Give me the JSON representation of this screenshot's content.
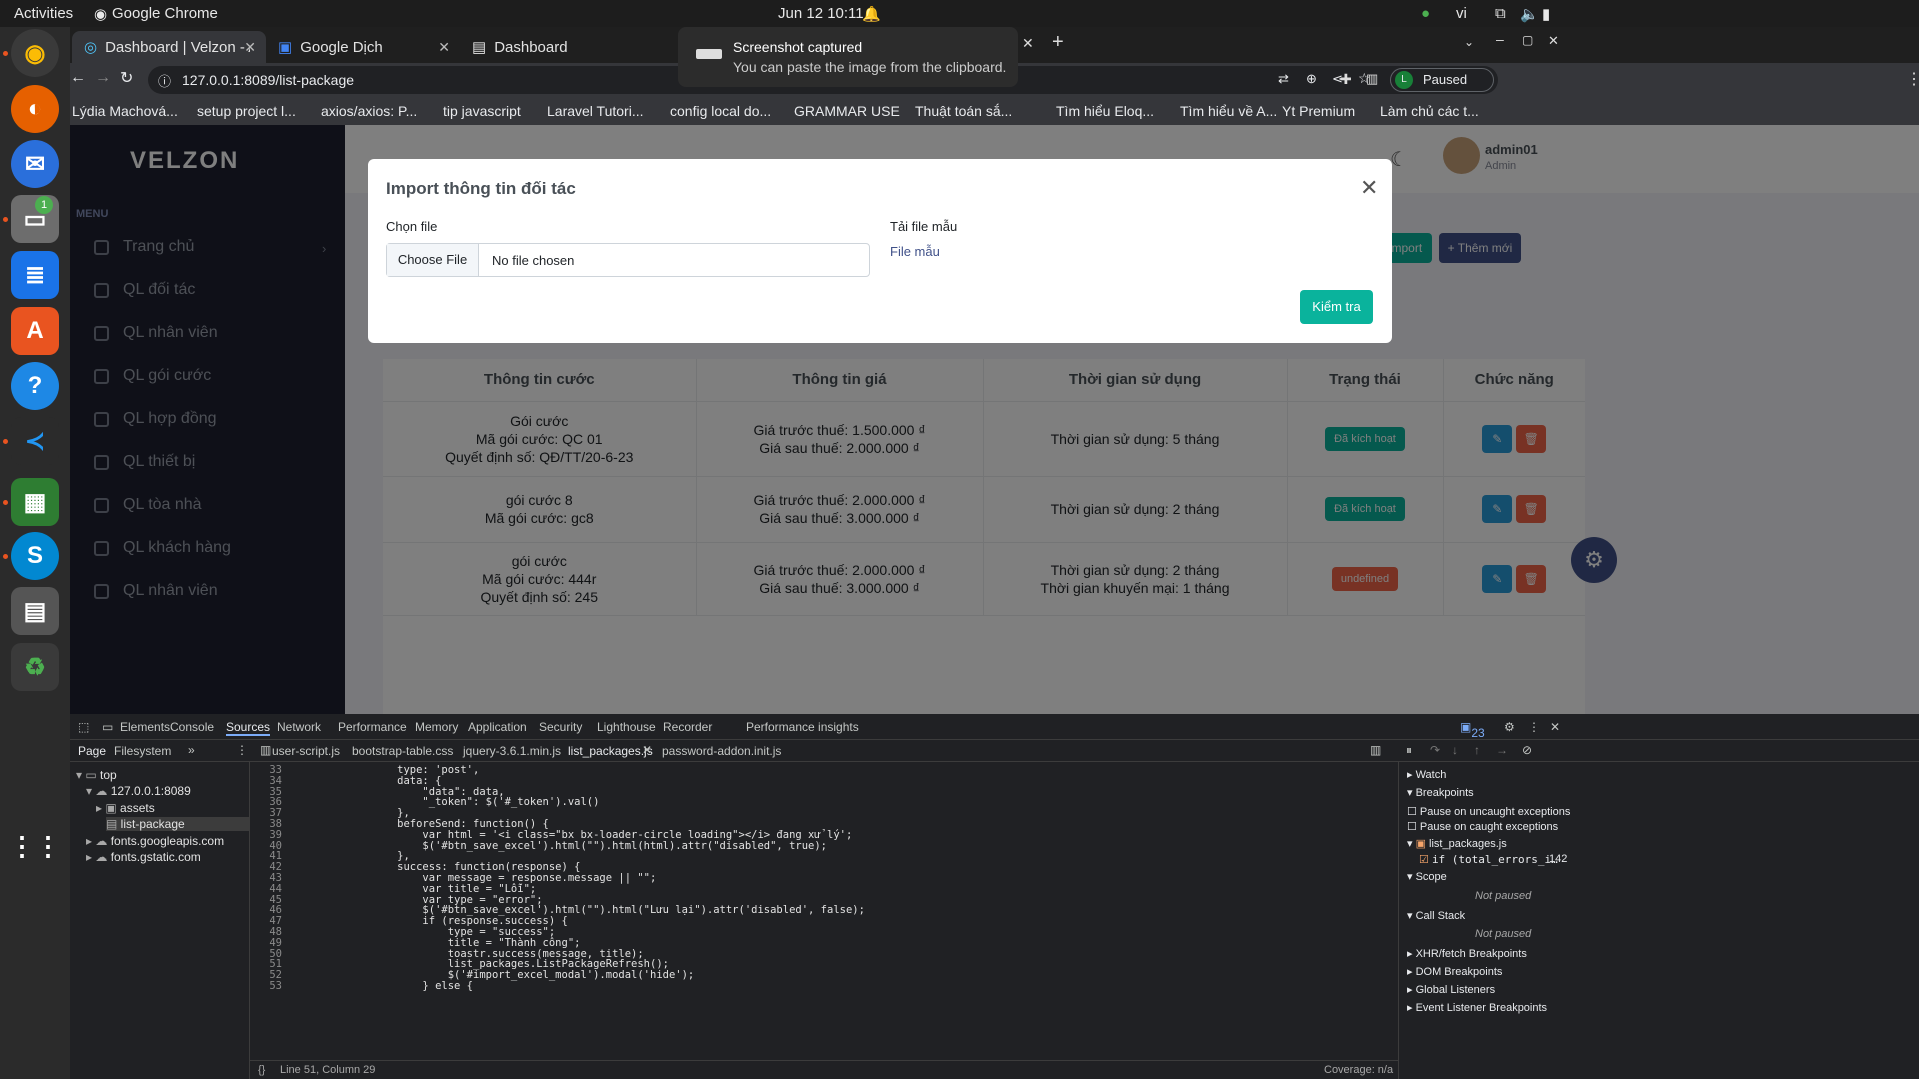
{
  "topbar": {
    "activities": "Activities",
    "app": "Google Chrome",
    "clock": "Jun 12  10:11",
    "lang": "vi"
  },
  "tabs": [
    {
      "label": "Dashboard | Velzon - Adm"
    },
    {
      "label": "Google Dịch"
    },
    {
      "label": "Dashboard"
    }
  ],
  "address": {
    "url": "127.0.0.1:8089/list-package",
    "profile": "Paused"
  },
  "bookmarks": [
    "Lýdia Machová...",
    "setup project l...",
    "axios/axios: P...",
    "tip javascript",
    "Laravel Tutori...",
    "config local do...",
    "GRAMMAR USE",
    "Thuật toán sắ...",
    "Tìm hiểu Eloq...",
    "Tìm hiểu về A...",
    "Yt Premium",
    "Làm chủ các t..."
  ],
  "toast": {
    "title": "Screenshot captured",
    "body": "You can paste the image from the clipboard."
  },
  "app": {
    "logo": "VELZON",
    "menu_title": "MENU",
    "menu": [
      "Trang chủ",
      "QL đối tác",
      "QL nhân viên",
      "QL gói cước",
      "QL hợp đồng",
      "QL thiết bị",
      "QL tòa nhà",
      "QL khách hàng",
      "QL nhân viên"
    ],
    "user": {
      "name": "admin01",
      "role": "Admin"
    },
    "import_button": "Import",
    "add_button": "Thêm mới"
  },
  "modal": {
    "title": "Import thông tin đối tác",
    "file_label": "Chọn file",
    "choose_file": "Choose File",
    "no_file": "No file chosen",
    "template_label": "Tải file mẫu",
    "template_link": "File mẫu",
    "check_button": "Kiểm tra"
  },
  "table": {
    "headers": [
      "Thông tin cước",
      "Thông tin giá",
      "Thời gian sử dụng",
      "Trạng thái",
      "Chức năng"
    ],
    "rows": [
      {
        "info": [
          "Gói cước",
          "Mã gói cước: QC 01",
          "Quyết định số: QĐ/TT/20-6-23"
        ],
        "price": [
          "Giá trước thuế: 1.500.000 ₫",
          "Giá sau thuế: 2.000.000 ₫"
        ],
        "time": [
          "Thời gian sử dụng: 5 tháng"
        ],
        "status": "Đã kích hoạt",
        "status_color": "#0ab39c"
      },
      {
        "info": [
          "gói cước 8",
          "Mã gói cước: gc8"
        ],
        "price": [
          "Giá trước thuế: 2.000.000 ₫",
          "Giá sau thuế: 3.000.000 ₫"
        ],
        "time": [
          "Thời gian sử dụng: 2 tháng"
        ],
        "status": "Đã kích hoạt",
        "status_color": "#0ab39c"
      },
      {
        "info": [
          "gói cước",
          "Mã gói cước: 444r",
          "Quyết định số: 245"
        ],
        "price": [
          "Giá trước thuế: 2.000.000 ₫",
          "Giá sau thuế: 3.000.000 ₫"
        ],
        "time": [
          "Thời gian sử dụng: 2 tháng",
          "Thời gian khuyến mại: 1 tháng"
        ],
        "status": "undefined",
        "status_color": "#f06548"
      }
    ]
  },
  "devtools": {
    "tabs": [
      "Elements",
      "Console",
      "Sources",
      "Network",
      "Performance",
      "Memory",
      "Application",
      "Security",
      "Lighthouse",
      "Recorder",
      "Performance insights"
    ],
    "issues": "23",
    "nav_tabs": [
      "Page",
      "Filesystem"
    ],
    "file_tabs": [
      "user-script.js",
      "bootstrap-table.css",
      "jquery-3.6.1.min.js",
      "list_packages.js",
      "password-addon.init.js"
    ],
    "tree": [
      "top",
      "127.0.0.1:8089",
      "assets",
      "list-package",
      "fonts.googleapis.com",
      "fonts.gstatic.com"
    ],
    "code_start": 33,
    "code": [
      "                type: 'post',",
      "                data: {",
      "                    \"data\": data,",
      "                    \"_token\": $('#_token').val()",
      "                },",
      "                beforeSend: function() {",
      "                    var html = '<i class=\"bx bx-loader-circle loading\"></i> đang xử lý';",
      "                    $('#btn_save_excel').html(\"\").html(html).attr(\"disabled\", true);",
      "                },",
      "                success: function(response) {",
      "                    var message = response.message || \"\";",
      "                    var title = \"Lỗi\";",
      "                    var type = \"error\";",
      "                    $('#btn_save_excel').html(\"\").html(\"Lưu lại\").attr('disabled', false);",
      "                    if (response.success) {",
      "                        type = \"success\";",
      "                        title = \"Thành công\";",
      "                        toastr.success(message, title);",
      "                        list_packages.ListPackageRefresh();",
      "                        $('#import_excel_modal').modal('hide');",
      "                    } else {"
    ],
    "status": "Line 51, Column 29",
    "coverage": "Coverage: n/a",
    "debugger": {
      "watch": "Watch",
      "breakpoints": "Breakpoints",
      "uncaught": "Pause on uncaught exceptions",
      "caught": "Pause on caught exceptions",
      "bp_file": "list_packages.js",
      "bp_line": "if (total_errors_i…",
      "bp_num": "142",
      "scope": "Scope",
      "not_paused": "Not paused",
      "callstack": "Call Stack",
      "xhr": "XHR/fetch Breakpoints",
      "dom": "DOM Breakpoints",
      "global": "Global Listeners",
      "event": "Event Listener Breakpoints"
    }
  }
}
